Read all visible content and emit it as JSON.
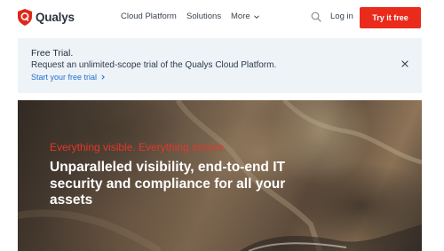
{
  "header": {
    "logo_text": "Qualys",
    "nav": {
      "cloud_platform": "Cloud Platform",
      "solutions": "Solutions",
      "more": "More"
    },
    "login": "Log in",
    "cta": "Try it free"
  },
  "banner": {
    "title": "Free Trial.",
    "text": "Request an unlimited-scope trial of the Qualys Cloud Platform.",
    "link": "Start your free trial"
  },
  "hero": {
    "tagline": "Everything visible. Everything secure.",
    "headline": "Unparalleled visibility, end-to-end IT security and compliance for all your assets"
  },
  "colors": {
    "brand_red": "#ea2b1c",
    "link_blue": "#1f6fd0",
    "banner_bg": "#eef3f8"
  },
  "icons": [
    "qualys-shield-icon",
    "chevron-down-icon",
    "search-icon",
    "chevron-right-icon",
    "close-icon"
  ]
}
